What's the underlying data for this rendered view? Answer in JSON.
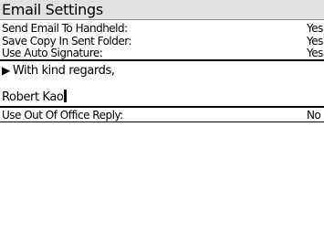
{
  "title": "Email Settings",
  "settings": [
    {
      "label": "Send Email To Handheld:",
      "value": "Yes"
    },
    {
      "label": "Save Copy In Sent Folder:",
      "value": "Yes"
    },
    {
      "label": "Use Auto Signature:",
      "value": "Yes"
    }
  ],
  "signature": {
    "marker": "▶",
    "line1": "With kind regards,",
    "line2": "Robert Kao"
  },
  "out_of_office": {
    "label": "Use Out Of Office Reply:",
    "value": "No"
  }
}
